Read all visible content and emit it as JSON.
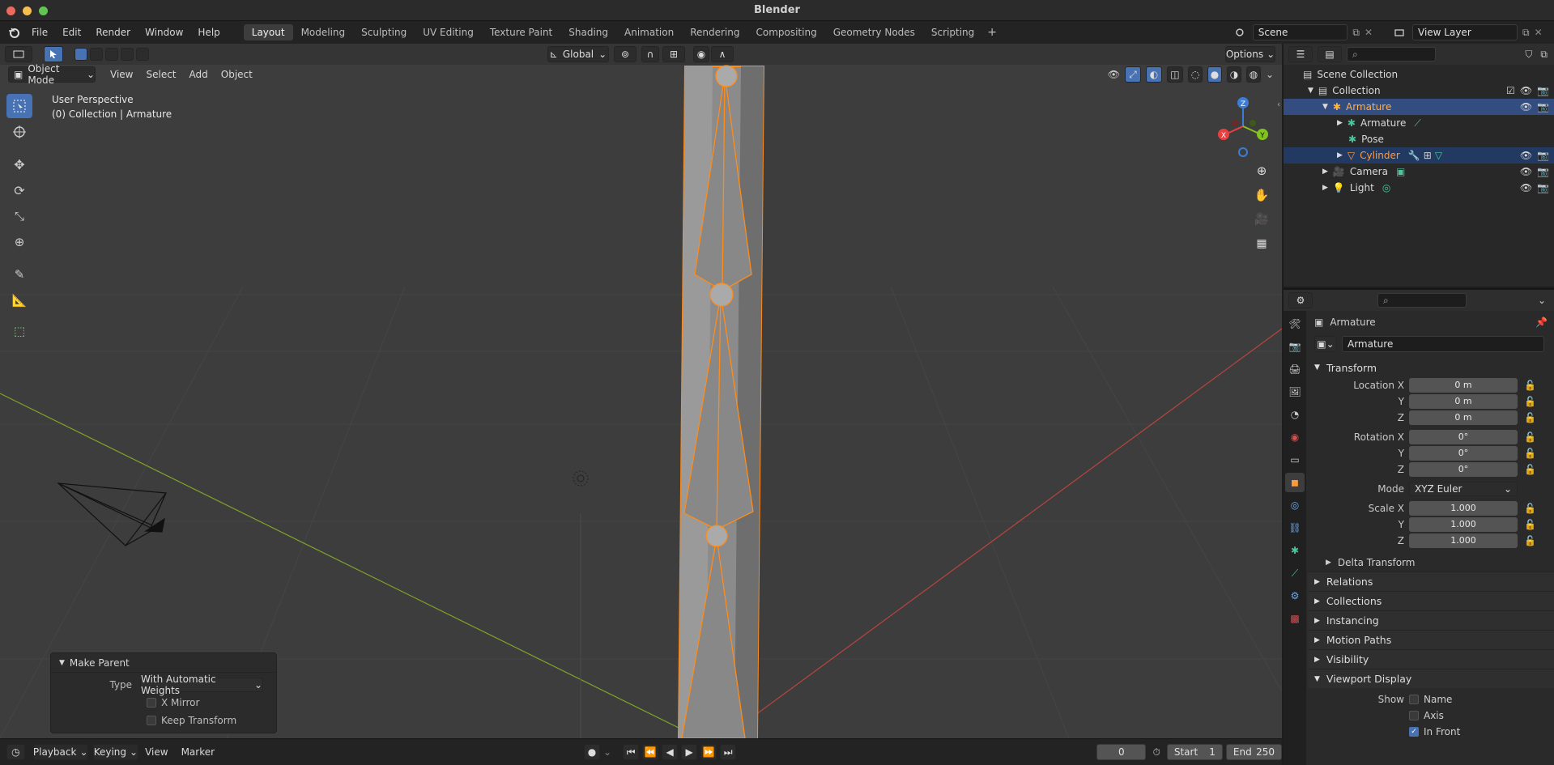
{
  "window": {
    "title": "Blender"
  },
  "menu": {
    "file": "File",
    "edit": "Edit",
    "render": "Render",
    "window": "Window",
    "help": "Help"
  },
  "workspaces": [
    "Layout",
    "Modeling",
    "Sculpting",
    "UV Editing",
    "Texture Paint",
    "Shading",
    "Animation",
    "Rendering",
    "Compositing",
    "Geometry Nodes",
    "Scripting"
  ],
  "active_workspace": "Layout",
  "scene": {
    "name": "Scene",
    "view_layer": "View Layer"
  },
  "viewport": {
    "mode": "Object Mode",
    "menus": {
      "view": "View",
      "select": "Select",
      "add": "Add",
      "object": "Object"
    },
    "transform_orientation": "Global",
    "options_label": "Options",
    "perspective": "User Perspective",
    "context": "(0) Collection | Armature",
    "gizmo": {
      "x": "X",
      "y": "Y",
      "z": "Z"
    }
  },
  "operator_panel": {
    "title": "Make Parent",
    "type_label": "Type",
    "type_value": "With Automatic Weights",
    "x_mirror": "X Mirror",
    "keep_transform": "Keep Transform"
  },
  "timeline": {
    "playback": "Playback",
    "keying": "Keying",
    "view": "View",
    "marker": "Marker",
    "current_frame": "0",
    "start_label": "Start",
    "start": "1",
    "end_label": "End",
    "end": "250"
  },
  "outliner": {
    "items": [
      {
        "label": "Scene Collection"
      },
      {
        "label": "Collection"
      },
      {
        "label": "Armature"
      },
      {
        "label": "Armature"
      },
      {
        "label": "Pose"
      },
      {
        "label": "Cylinder"
      },
      {
        "label": "Camera"
      },
      {
        "label": "Light"
      }
    ]
  },
  "properties": {
    "object_name": "Armature",
    "object_field": "Armature",
    "transform": "Transform",
    "location_x_label": "Location X",
    "y_label": "Y",
    "z_label": "Z",
    "location": [
      "0 m",
      "0 m",
      "0 m"
    ],
    "rotation_x_label": "Rotation X",
    "rotation": [
      "0°",
      "0°",
      "0°"
    ],
    "mode_label": "Mode",
    "mode_value": "XYZ Euler",
    "scale_x_label": "Scale X",
    "scale": [
      "1.000",
      "1.000",
      "1.000"
    ],
    "sections": [
      "Delta Transform",
      "Relations",
      "Collections",
      "Instancing",
      "Motion Paths",
      "Visibility",
      "Viewport Display"
    ],
    "show_label": "Show",
    "show_name": "Name",
    "show_axis": "Axis",
    "show_in_front": "In Front"
  },
  "colors": {
    "accent": "#4772b3",
    "selection": "#ff8c19",
    "x_axis": "#e84040",
    "y_axis": "#82c41e",
    "z_axis": "#3b7dd8"
  }
}
